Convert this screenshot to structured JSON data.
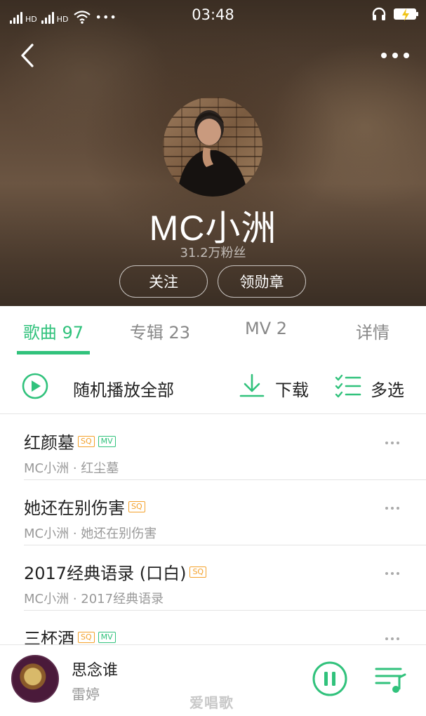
{
  "status_bar": {
    "time": "03:48",
    "sim1_label": "HD",
    "sim2_label": "HD",
    "overflow": "•••",
    "icons": [
      "signal-icon",
      "wifi-icon",
      "headphone-icon",
      "battery-charging-icon"
    ]
  },
  "header": {
    "artist_name": "MC小洲",
    "fans": "31.2万粉丝",
    "follow_label": "关注",
    "badge_label": "领勋章",
    "back_icon": "back-arrow-icon",
    "menu_icon": "more-horizontal-icon"
  },
  "tabs": [
    {
      "label": "歌曲 97",
      "active": true
    },
    {
      "label": "专辑 23",
      "active": false
    },
    {
      "label": "MV 2",
      "active": false
    },
    {
      "label": "详情",
      "active": false
    }
  ],
  "actions": {
    "shuffle_label": "随机播放全部",
    "download_label": "下载",
    "multiselect_label": "多选"
  },
  "songs": [
    {
      "title": "红颜墓",
      "tags": [
        "SQ",
        "MV"
      ],
      "subtitle": "MC小洲 · 红尘墓"
    },
    {
      "title": "她还在别伤害",
      "tags": [
        "SQ"
      ],
      "subtitle": "MC小洲 · 她还在别伤害"
    },
    {
      "title": "2017经典语录 (口白)",
      "tags": [
        "SQ"
      ],
      "subtitle": "MC小洲 · 2017经典语录"
    },
    {
      "title": "三杯酒",
      "tags": [
        "SQ",
        "MV"
      ],
      "subtitle": ""
    }
  ],
  "player": {
    "title": "思念谁",
    "artist": "雷婷",
    "watermark": "爱唱歌"
  },
  "colors": {
    "accent": "#31c27c",
    "sq_tag": "#f4a12a",
    "muted_text": "#999999"
  }
}
